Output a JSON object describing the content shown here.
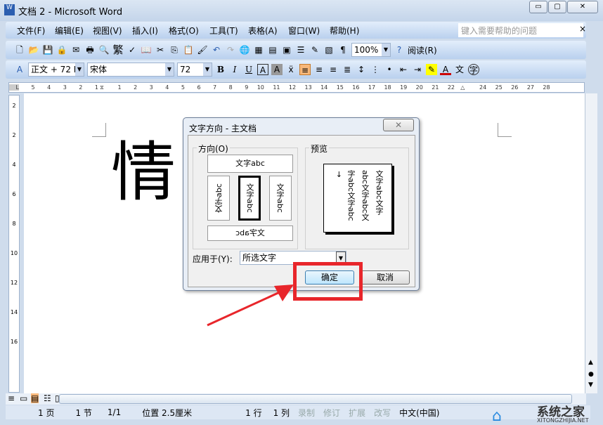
{
  "window": {
    "title": "文档 2 - Microsoft Word",
    "minimize": "▭",
    "restore": "▢",
    "close": "✕"
  },
  "menu": {
    "items": [
      "文件(F)",
      "编辑(E)",
      "视图(V)",
      "插入(I)",
      "格式(O)",
      "工具(T)",
      "表格(A)",
      "窗口(W)",
      "帮助(H)"
    ],
    "help_placeholder": "键入需要帮助的问题",
    "close": "×"
  },
  "toolbar": {
    "zoom": "100%",
    "read": "阅读(R)",
    "trad": "繁"
  },
  "format": {
    "style": "正文 + 72 I",
    "font": "宋体",
    "size": "72",
    "bold": "B",
    "italic": "I",
    "underline": "U"
  },
  "ruler": {
    "left": [
      "5",
      "4",
      "3",
      "2",
      "1"
    ],
    "right": [
      "1",
      "2",
      "3",
      "4",
      "5",
      "6",
      "7",
      "8",
      "9",
      "10",
      "11",
      "12",
      "13",
      "14",
      "15",
      "16",
      "17",
      "18",
      "19",
      "20",
      "21",
      "22",
      "",
      "24",
      "25",
      "26",
      "27",
      "28"
    ],
    "vertical": [
      "2",
      "2",
      "4",
      "6",
      "8",
      "10",
      "12",
      "14",
      "16"
    ]
  },
  "document": {
    "text": "情"
  },
  "dialog": {
    "title": "文字方向 - 主文档",
    "close": "✕",
    "orientation_label": "方向(O)",
    "preview_label": "预览",
    "options": [
      "文字abc",
      "文字abc",
      "文字abc",
      "文字abc",
      "文字abc"
    ],
    "preview_lines": [
      "文字abc文字",
      "abc文字abc文",
      "字abc文字abc"
    ],
    "apply_label": "应用于(Y):",
    "apply_value": "所选文字",
    "ok": "确定",
    "cancel": "取消"
  },
  "status": {
    "page": "1 页",
    "section": "1 节",
    "pages": "1/1",
    "position": "位置 2.5厘米",
    "line": "1 行",
    "col": "1 列",
    "rec": "录制",
    "trk": "修订",
    "ext": "扩展",
    "ovr": "改写",
    "lang": "中文(中国)"
  },
  "watermark": {
    "name": "系统之家",
    "url": "XITONGZHIJIA.NET"
  },
  "colors": {
    "highlight": "#e8262b",
    "accent": "#316ac5"
  }
}
